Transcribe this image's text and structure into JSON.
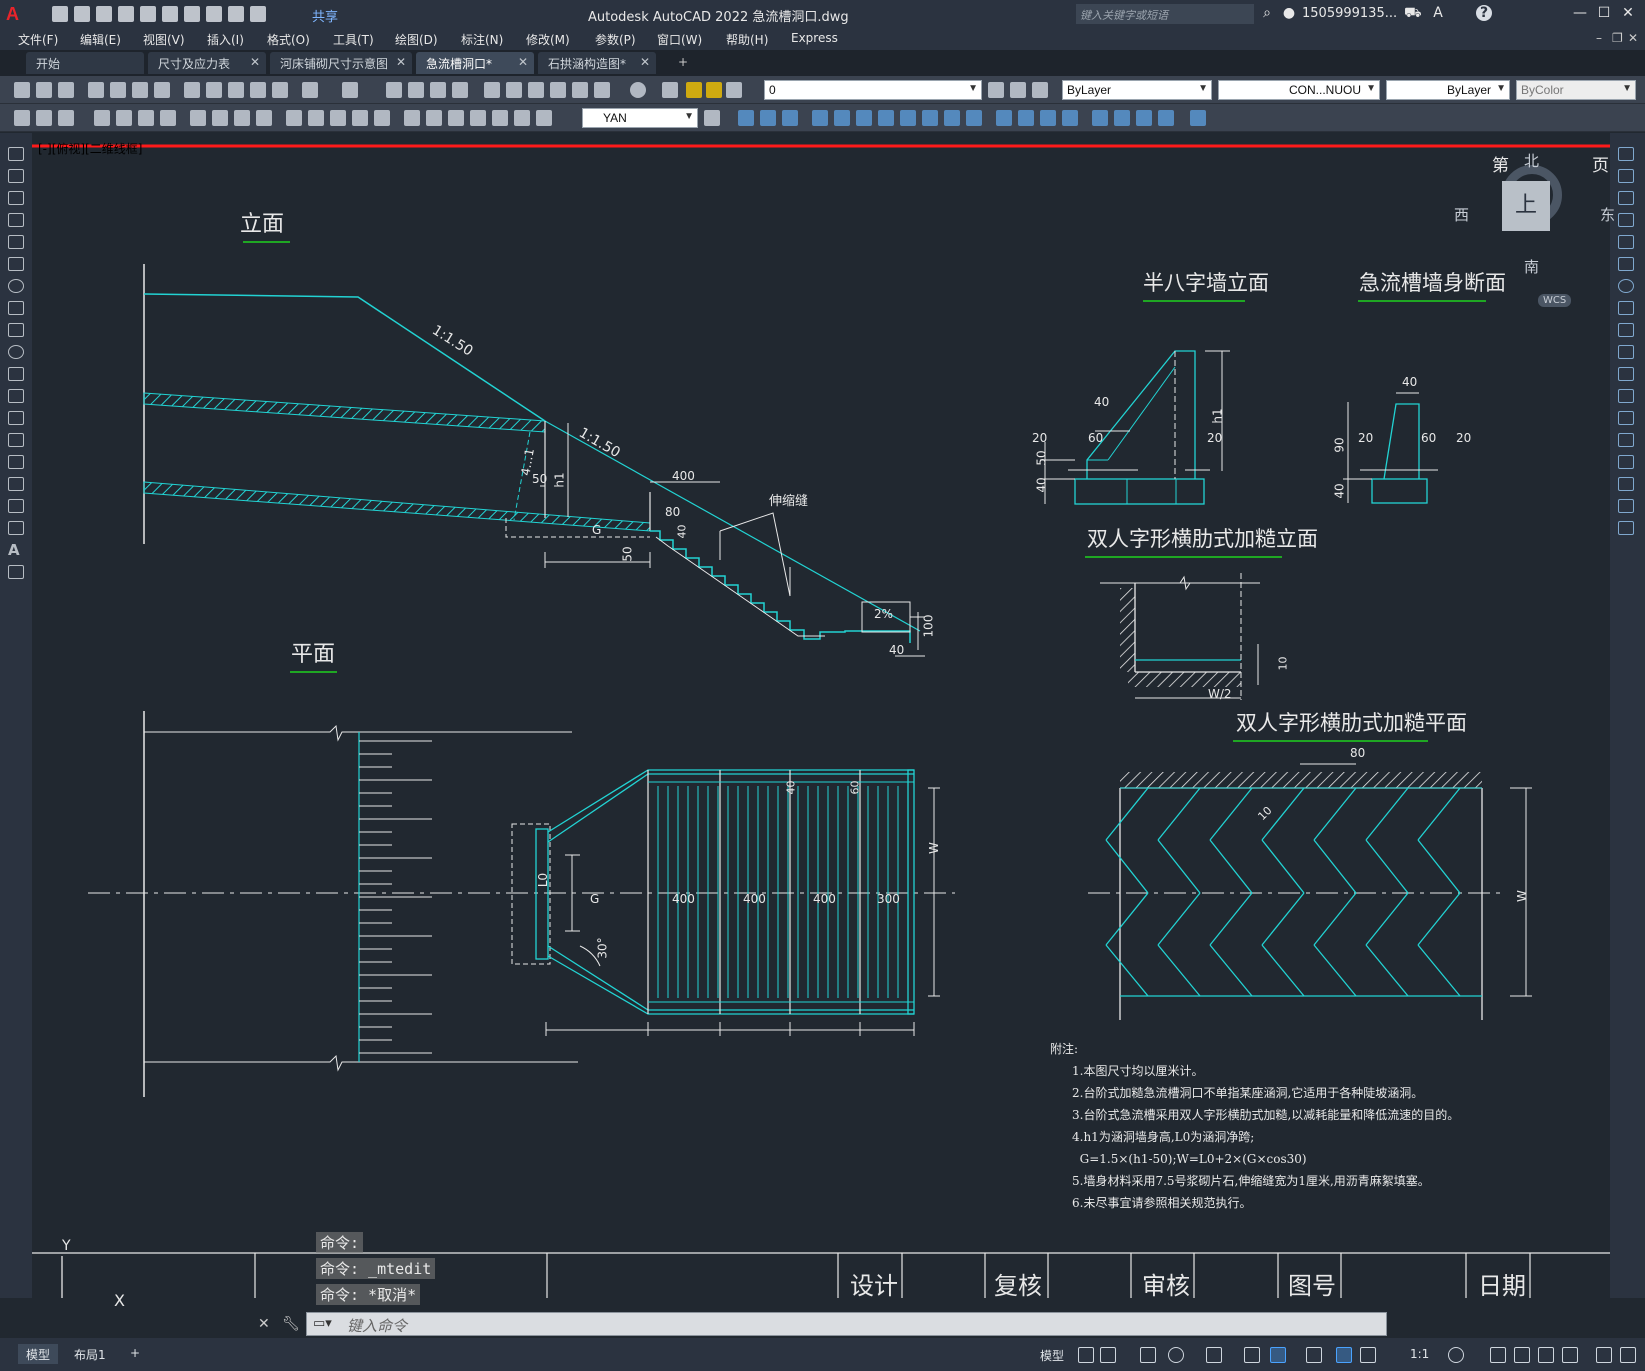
{
  "title_bar": {
    "logo": "A",
    "share_label": "共享",
    "app_title": "Autodesk AutoCAD 2022    急流槽洞口.dwg",
    "search_placeholder": "键入关键字或短语",
    "user": "1505999135...",
    "help": "?"
  },
  "menu": [
    "文件(F)",
    "编辑(E)",
    "视图(V)",
    "插入(I)",
    "格式(O)",
    "工具(T)",
    "绘图(D)",
    "标注(N)",
    "修改(M)",
    "参数(P)",
    "窗口(W)",
    "帮助(H)",
    "Express"
  ],
  "file_tabs": [
    {
      "label": "开始",
      "closable": false
    },
    {
      "label": "尺寸及应力表",
      "closable": true
    },
    {
      "label": "河床铺砌尺寸示意图",
      "closable": true
    },
    {
      "label": "急流槽洞口*",
      "closable": true,
      "active": true
    },
    {
      "label": "石拱涵构造图*",
      "closable": true
    }
  ],
  "new_tab": "+",
  "toolbar": {
    "layer_value": "0",
    "color_value": "ByLayer",
    "linetype_value": "CON...NUOU",
    "lineweight_value": "ByLayer",
    "plotstyle_value": "ByColor",
    "dimstyle_value": "YAN"
  },
  "viewport_label": "[-][俯视][二维线框]",
  "viewcube": {
    "north": "北",
    "south": "南",
    "east": "东",
    "west": "西",
    "face": "上",
    "wcs": "WCS"
  },
  "drawing": {
    "title_elev": "立面",
    "title_plan": "平面",
    "title_half_wall": "半八字墙立面",
    "title_wall_section": "急流槽墙身断面",
    "title_rib_elev": "双人字形横肋式加糙立面",
    "title_rib_plan": "双人字形横肋式加糙平面",
    "slope1": "1:1.50",
    "slope2": "1:1.50",
    "joint": "伸缩缝",
    "grade": "2%",
    "frame_top_left": "第",
    "frame_top_right": "页",
    "dims": {
      "d400": "400",
      "d80": "80",
      "d50": "50",
      "d40": "40",
      "d60": "60",
      "d20": "20",
      "d90": "90",
      "d100": "100",
      "d10": "10",
      "d300": "300",
      "h1": "h1",
      "G": "G",
      "L0": "L0",
      "W": "W",
      "W2": "W/2",
      "a30": "30°",
      "d401": "40",
      "dLt": "4…1"
    },
    "notes": {
      "heading": "附注:",
      "lines": [
        "1.本图尺寸均以厘米计。",
        "2.台阶式加糙急流槽洞口不单指某座涵洞,它适用于各种陡坡涵洞。",
        "3.台阶式急流槽采用双人字形横肋式加糙,以减耗能量和降低流速的目的。",
        "4.h1为涵洞墙身高,L0为涵洞净跨;",
        "  G=1.5×(h1-50);W=L0+2×(G×cos30)",
        "5.墙身材料采用7.5号浆砌片石,伸缩缝宽为1厘米,用沥青麻絮填塞。",
        "6.未尽事宜请参照相关规范执行。"
      ]
    },
    "title_block": [
      "设计",
      "复核",
      "审核",
      "图号",
      "日期"
    ],
    "ucs_x": "X",
    "ucs_y": "Y"
  },
  "command": {
    "history": [
      "命令:",
      "命令: _mtedit",
      "命令: *取消*"
    ],
    "placeholder": "键入命令"
  },
  "layout_tabs": [
    "模型",
    "布局1"
  ],
  "add_layout": "+",
  "status": {
    "model": "模型",
    "scale": "1:1"
  },
  "colors": {
    "cyan": "#22d3d3",
    "red": "#ff1a1a",
    "background": "#212830"
  }
}
